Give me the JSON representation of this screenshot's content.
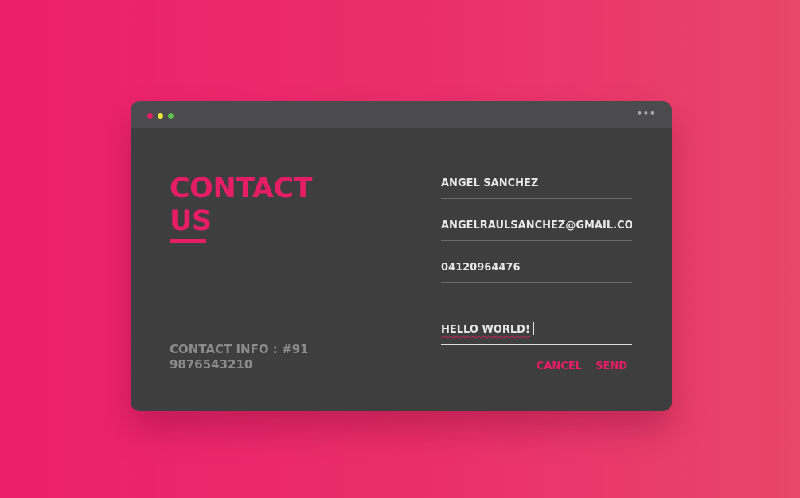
{
  "window": {
    "title_bar": {
      "dots": [
        "red",
        "yellow",
        "green"
      ],
      "more_icon": "ellipsis-icon"
    }
  },
  "left": {
    "heading_line1": "CONTACT",
    "heading_line2": "US",
    "contact_info": "CONTACT INFO : #91 9876543210"
  },
  "form": {
    "name": "ANGEL SANCHEZ",
    "email": "ANGELRAULSANCHEZ@GMAIL.COM",
    "phone": "04120964476",
    "message": "HELLO WORLD!"
  },
  "actions": {
    "cancel_label": "CANCEL",
    "send_label": "SEND"
  },
  "colors": {
    "accent": "#e51e63",
    "background_gradient": [
      "#ec1f6a",
      "#e8466a"
    ],
    "window": "#3e3e3e",
    "titlebar": "#4b4b4d"
  }
}
